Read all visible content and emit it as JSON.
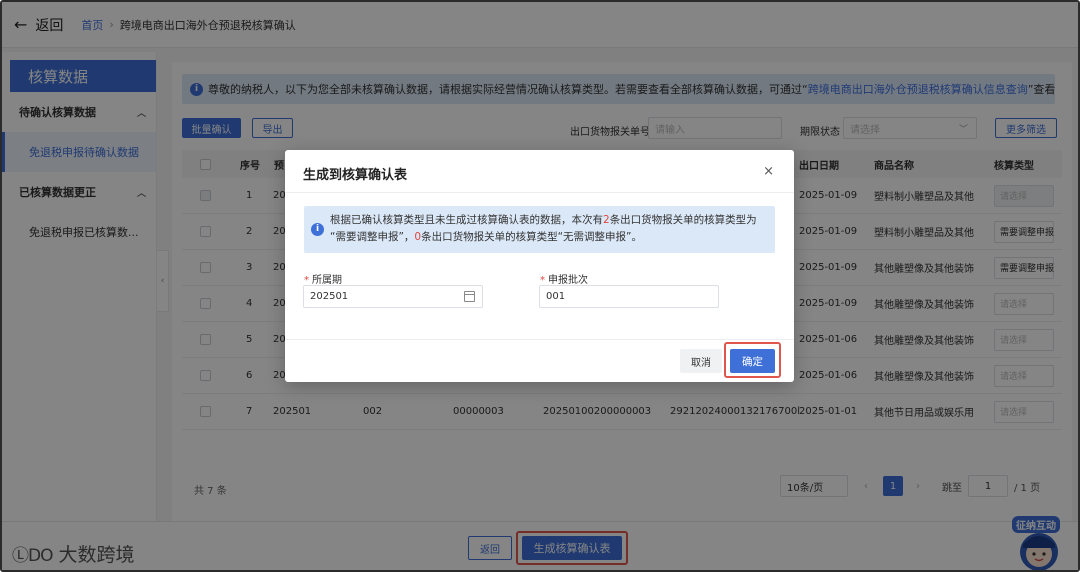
{
  "topbar": {
    "back_label": "返回",
    "breadcrumb_home": "首页",
    "breadcrumb_sep": "›",
    "breadcrumb_current": "跨境电商出口海外仓预退税核算确认"
  },
  "sidebar": {
    "title": "核算数据",
    "groups": [
      {
        "label": "待确认核算数据",
        "items": [
          {
            "label": "免退税申报待确认数据",
            "active": true
          }
        ]
      },
      {
        "label": "已核算数据更正",
        "items": [
          {
            "label": "免退税申报已核算数..."
          }
        ]
      }
    ]
  },
  "notice": {
    "text": "尊敬的纳税人，以下为您全部未核算确认数据，请根据实际经营情况确认核算类型。若需要查看全部核算确认数据，可通过“",
    "link": "跨境电商出口海外仓预退税核算确认信息查询",
    "suffix": "”查看。"
  },
  "toolbar": {
    "batch_confirm": "批量确认",
    "export": "导出",
    "declaration_label": "出口货物报关单号",
    "declaration_placeholder": "请输入",
    "status_label": "期限状态",
    "status_placeholder": "请选择",
    "more_filter": "更多筛选"
  },
  "table": {
    "headers": [
      "序号",
      "预",
      "出口日期",
      "商品名称",
      "核算类型"
    ],
    "rows": [
      {
        "no": "1",
        "c1": "20",
        "date": "2025-01-09",
        "name": "塑料制小雕塑品及其他",
        "type": "请选择",
        "disabled": true
      },
      {
        "no": "2",
        "c1": "20",
        "date": "2025-01-09",
        "name": "塑料制小雕塑品及其他",
        "type": "需要调整申报"
      },
      {
        "no": "3",
        "c1": "20",
        "date": "2025-01-09",
        "name": "其他雕塑像及其他装饰",
        "type": "需要调整申报"
      },
      {
        "no": "4",
        "c1": "20",
        "date": "2025-01-09",
        "name": "其他雕塑像及其他装饰",
        "type": "请选择"
      },
      {
        "no": "5",
        "c1": "20",
        "date": "2025-01-06",
        "name": "其他雕塑像及其他装饰",
        "type": "请选择"
      },
      {
        "no": "6",
        "c1": "20",
        "date": "2025-01-06",
        "name": "其他雕塑像及其他装饰",
        "type": "请选择"
      },
      {
        "no": "7",
        "c1": "202501",
        "c2": "002",
        "c3": "00000003",
        "c4": "20250100200000003",
        "c5": "29212024000132176700l",
        "date": "2025-01-01",
        "name": "其他节日用品或娱乐用",
        "type": "请选择"
      }
    ],
    "total": "共 7 条"
  },
  "pagination": {
    "page_size": "10条/页",
    "prev": "‹",
    "current": "1",
    "next": "›",
    "jump_label": "跳至",
    "jump_value": "1",
    "total_pages": "/ 1 页"
  },
  "bottombar": {
    "back": "返回",
    "generate": "生成核算确认表",
    "logo_mark": "ⓁDO",
    "logo_text": "大数跨境",
    "mascot_text": "征纳互动"
  },
  "modal": {
    "title": "生成到核算确认表",
    "close": "×",
    "alert_p1": "根据已确认核算类型且未生成过核算确认表的数据，本次有",
    "alert_n1": "2",
    "alert_p2": "条出口货物报关单的核算类型为",
    "alert_p3": "“需要调整申报”，",
    "alert_n2": "0",
    "alert_p4": "条出口货物报关单的核算类型“无需调整申报”。",
    "period_label": "所属期",
    "period_value": "202501",
    "batch_label": "申报批次",
    "batch_value": "001",
    "cancel": "取消",
    "confirm": "确定"
  },
  "colors": {
    "primary": "#3e70d8",
    "highlight": "#e0564f",
    "required": "#e0453f",
    "info_bg": "#dbe8f7"
  }
}
